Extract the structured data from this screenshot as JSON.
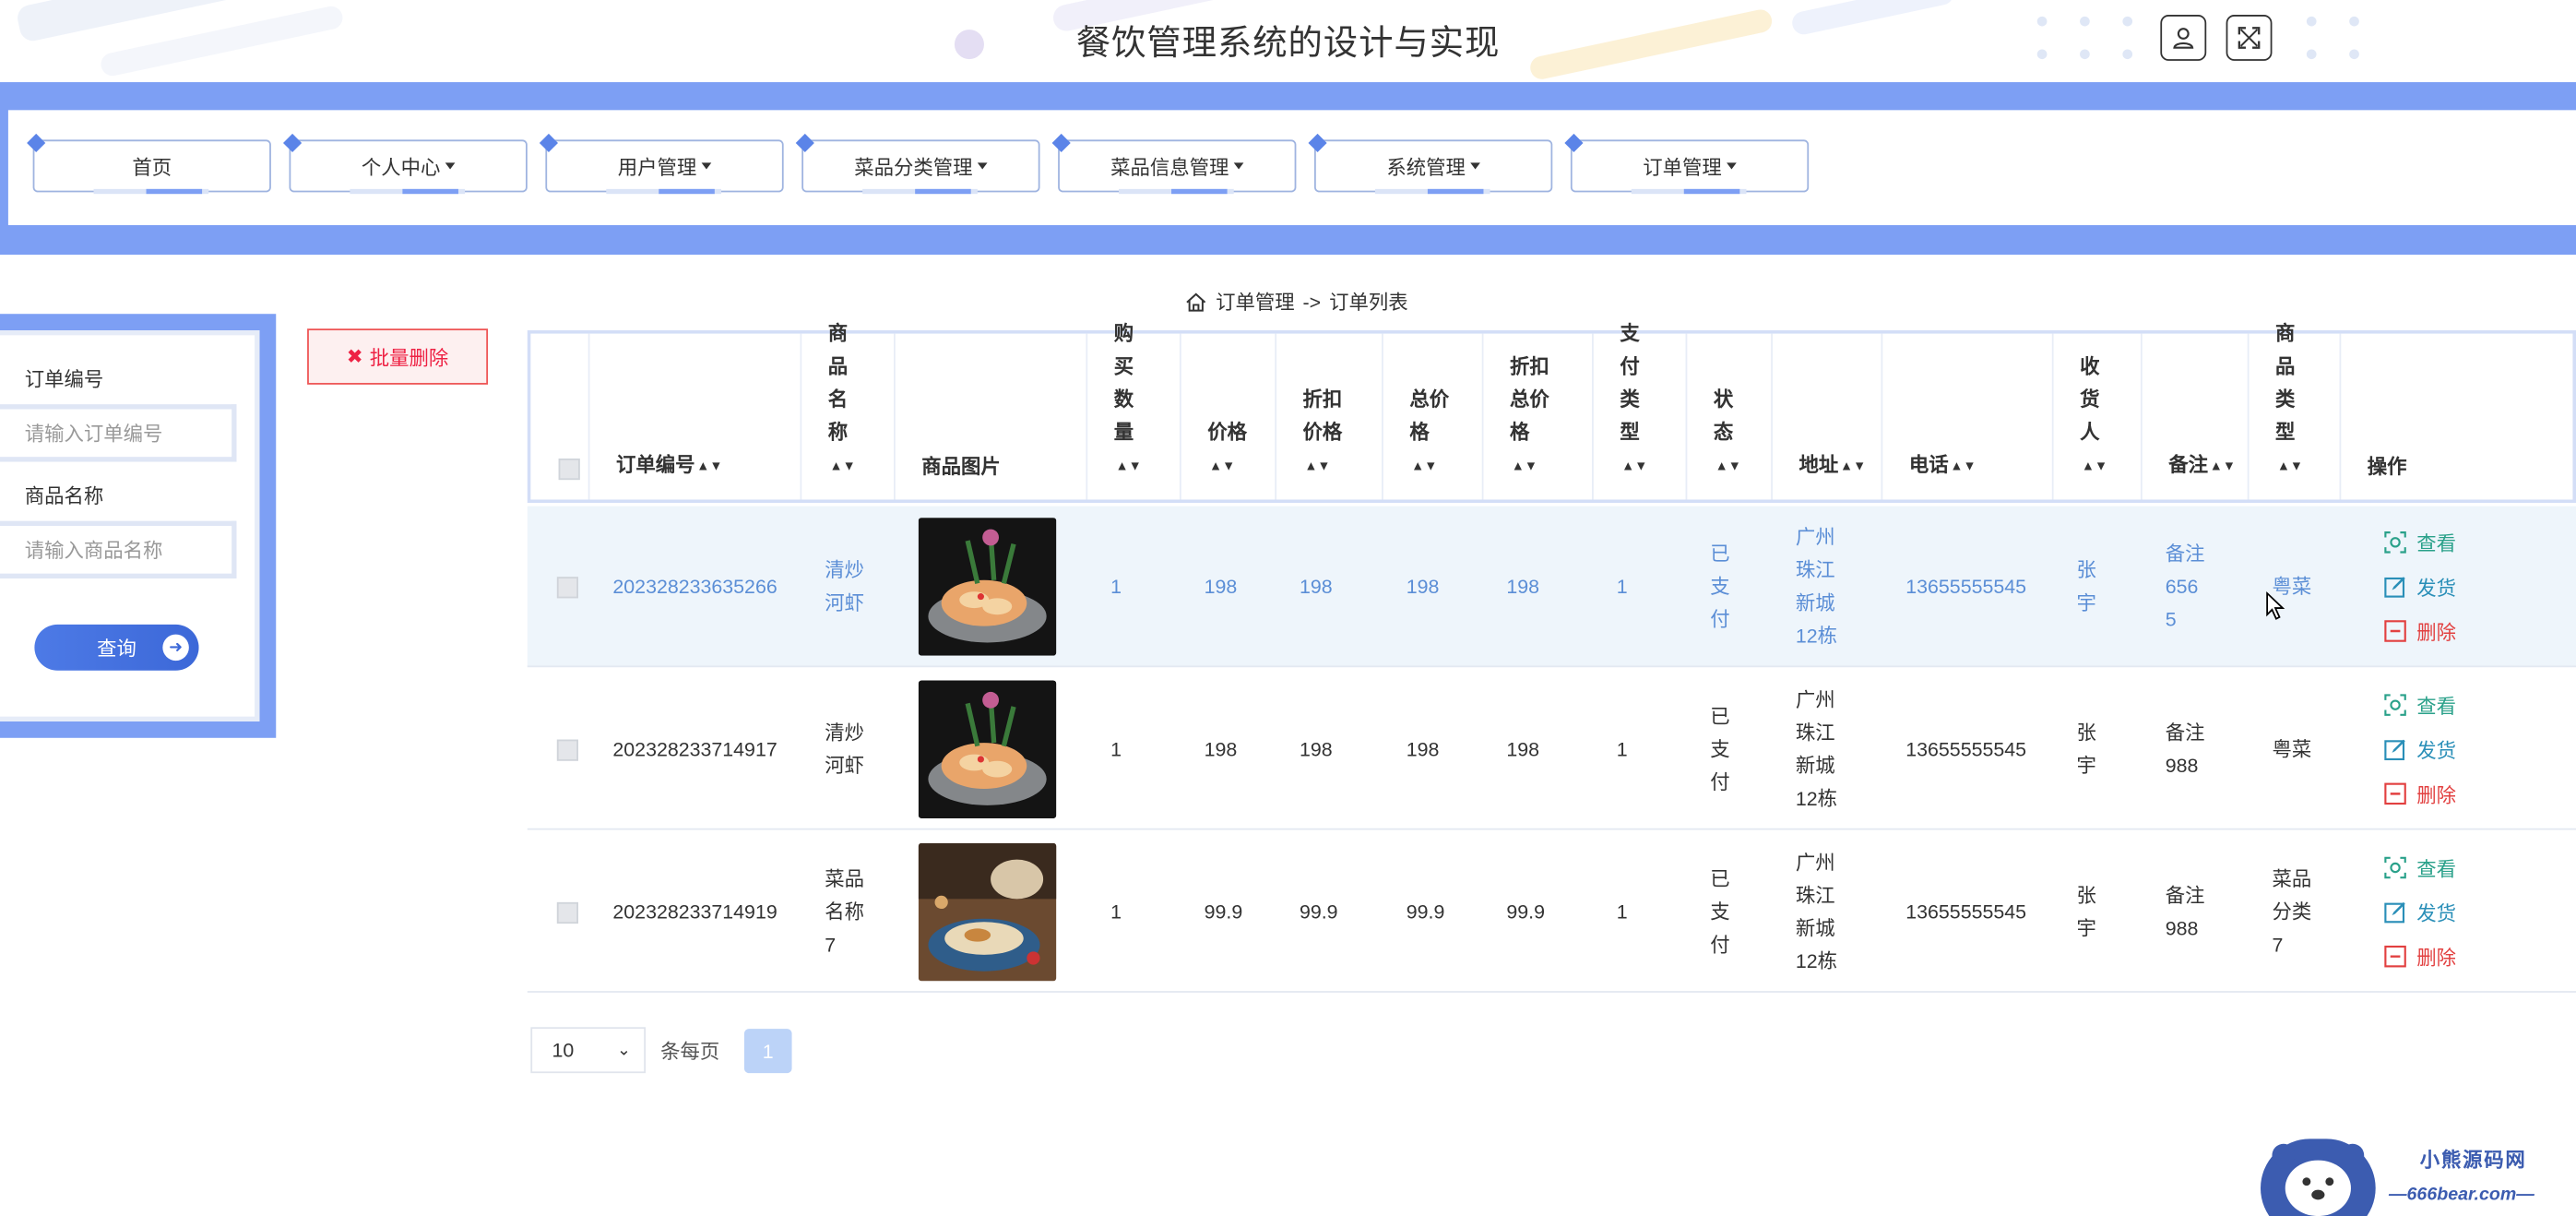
{
  "header": {
    "title": "餐饮管理系统的设计与实现",
    "user_icon": "user-icon",
    "fullscreen_icon": "expand-icon"
  },
  "nav": {
    "items": [
      {
        "label": "首页",
        "dropdown": false
      },
      {
        "label": "个人中心",
        "dropdown": true
      },
      {
        "label": "用户管理",
        "dropdown": true
      },
      {
        "label": "菜品分类管理",
        "dropdown": true
      },
      {
        "label": "菜品信息管理",
        "dropdown": true
      },
      {
        "label": "系统管理",
        "dropdown": true
      },
      {
        "label": "订单管理",
        "dropdown": true
      }
    ]
  },
  "search": {
    "order_no_label": "订单编号",
    "order_no_placeholder": "请输入订单编号",
    "product_label": "商品名称",
    "product_placeholder": "请输入商品名称",
    "query_button": "查询"
  },
  "toolbar": {
    "batch_delete": "批量删除"
  },
  "breadcrumb": {
    "section": "订单管理",
    "separator": "->",
    "page": "订单列表"
  },
  "table": {
    "columns": [
      "订单编号",
      "商品名称",
      "商品图片",
      "购买数量",
      "价格",
      "折扣价格",
      "总价格",
      "折扣总价格",
      "支付类型",
      "状态",
      "地址",
      "电话",
      "收货人",
      "备注",
      "商品类型",
      "操作"
    ],
    "rows": [
      {
        "order_no": "202328233635266",
        "product": "清炒河虾",
        "qty": "1",
        "price": "198",
        "discount_price": "198",
        "total": "198",
        "discount_total": "198",
        "pay_type": "1",
        "status": "已支付",
        "address": "广州珠江新城12栋",
        "phone": "13655555545",
        "receiver": "张宇",
        "remark": "备注6565",
        "category": "粤菜",
        "highlighted": true
      },
      {
        "order_no": "202328233714917",
        "product": "清炒河虾",
        "qty": "1",
        "price": "198",
        "discount_price": "198",
        "total": "198",
        "discount_total": "198",
        "pay_type": "1",
        "status": "已支付",
        "address": "广州珠江新城12栋",
        "phone": "13655555545",
        "receiver": "张宇",
        "remark": "备注988",
        "category": "粤菜",
        "highlighted": false
      },
      {
        "order_no": "202328233714919",
        "product": "菜品名称7",
        "qty": "1",
        "price": "99.9",
        "discount_price": "99.9",
        "total": "99.9",
        "discount_total": "99.9",
        "pay_type": "1",
        "status": "已支付",
        "address": "广州珠江新城12栋",
        "phone": "13655555545",
        "receiver": "张宇",
        "remark": "备注988",
        "category": "菜品分类7",
        "highlighted": false
      }
    ],
    "actions": {
      "view": "查看",
      "ship": "发货",
      "delete": "删除"
    }
  },
  "pagination": {
    "page_size": "10",
    "per_page_label": "条每页",
    "current_page": "1"
  },
  "watermark": {
    "name": "小熊源码网",
    "url": "—666bear.com—"
  },
  "colors": {
    "accent": "#7d9ff4",
    "primary": "#3c68d8",
    "danger": "#e24040",
    "highlight_row": "#eef5fb"
  }
}
